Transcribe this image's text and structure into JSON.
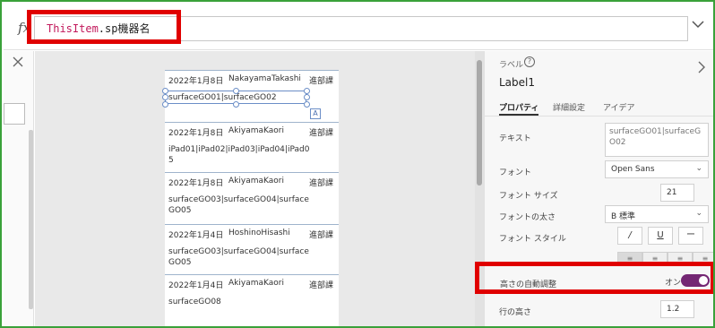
{
  "formula_bar": {
    "fx_label": "fx",
    "formula_keyword": "ThisItem",
    "formula_rest": ".sp機器名"
  },
  "gallery": {
    "items": [
      {
        "date": "2022年1月8日",
        "name": "NakayamaTakashi",
        "dept": "進部課",
        "devices": "surfaceGO01|surfaceGO02"
      },
      {
        "date": "2022年1月8日",
        "name": "AkiyamaKaori",
        "dept": "進部課",
        "devices": "iPad01|iPad02|iPad03|iPad04|iPad05"
      },
      {
        "date": "2022年1月8日",
        "name": "AkiyamaKaori",
        "dept": "進部課",
        "devices": "surfaceGO03|surfaceGO04|surfaceGO05"
      },
      {
        "date": "2022年1月4日",
        "name": "HoshinoHisashi",
        "dept": "進部課",
        "devices": "surfaceGO03|surfaceGO04|surfaceGO05"
      },
      {
        "date": "2022年1月4日",
        "name": "AkiyamaKaori",
        "dept": "進部課",
        "devices": "surfaceGO08"
      }
    ]
  },
  "properties": {
    "control_type": "ラベル",
    "control_name": "Label1",
    "tabs": [
      "プロパティ",
      "詳細設定",
      "アイデア"
    ],
    "text_label": "テキスト",
    "text_value": "surfaceGO01|surfaceGO02",
    "font_label": "フォント",
    "font_value": "Open Sans",
    "font_size_label": "フォント サイズ",
    "font_size_value": "21",
    "font_weight_label": "フォントの太さ",
    "font_weight_value": "B 標準",
    "font_style_label": "フォント スタイル",
    "style_italic": "/",
    "style_underline": "U",
    "style_strike": "ー",
    "auto_height_label": "高さの自動調整",
    "auto_height_value": "オン",
    "line_height_label": "行の高さ",
    "line_height_value": "1.2"
  }
}
